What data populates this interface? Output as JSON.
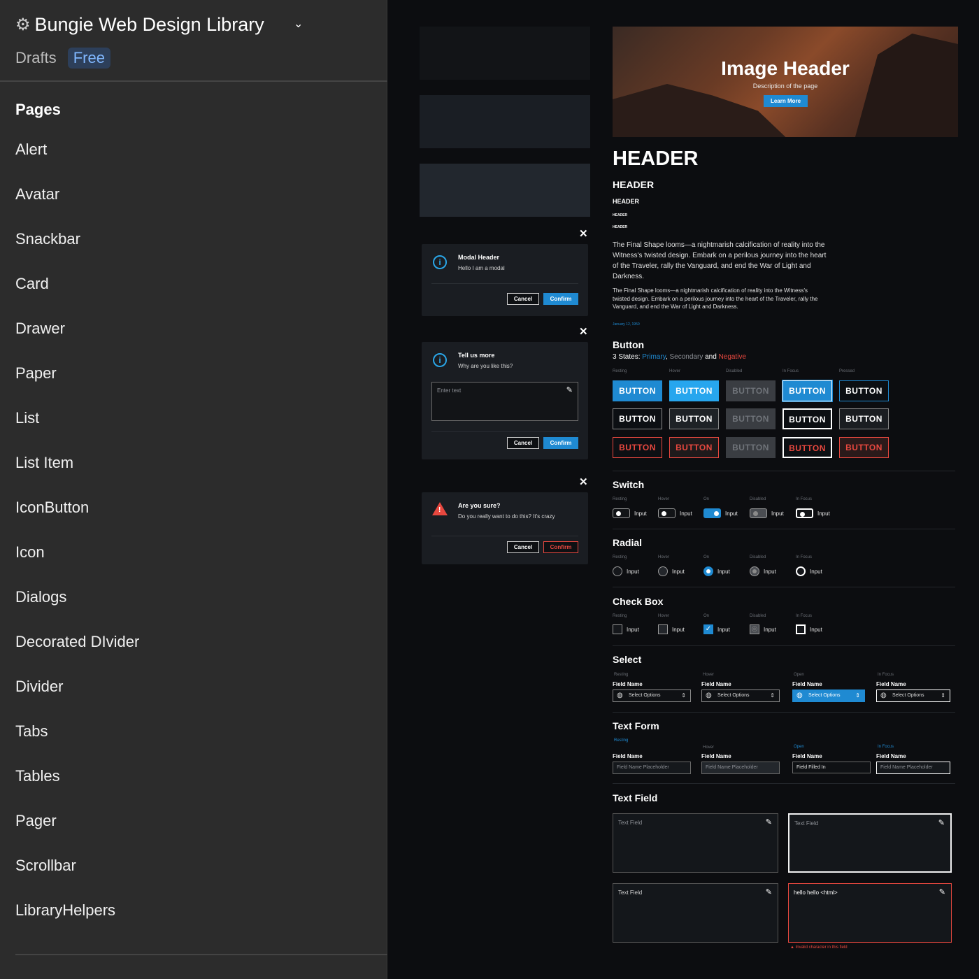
{
  "sidebar": {
    "title": "Bungie Web Design Library",
    "drafts": "Drafts",
    "plan": "Free",
    "pages_heading": "Pages",
    "pages": [
      "Alert",
      "Avatar",
      "Snackbar",
      "Card",
      "Drawer",
      "Paper",
      "List",
      "List Item",
      "IconButton",
      "Icon",
      "Dialogs",
      "Decorated DIvider",
      "Divider",
      "Tabs",
      "Tables",
      "Pager",
      "Scrollbar",
      "LibraryHelpers"
    ]
  },
  "swatches": [
    "#121417",
    "#1a1e24",
    "#22272e"
  ],
  "modals": {
    "m1": {
      "title": "Modal Header",
      "body": "Hello I am a modal",
      "cancel": "Cancel",
      "confirm": "Confirm"
    },
    "m2": {
      "title": "Tell us more",
      "body": "Why are you like this?",
      "placeholder": "Enter text",
      "cancel": "Cancel",
      "confirm": "Confirm"
    },
    "m3": {
      "title": "Are you sure?",
      "body": "Do you really want to do this? It's crazy",
      "cancel": "Cancel",
      "confirm": "Confirm"
    }
  },
  "hero": {
    "title": "Image Header",
    "subtitle": "Description of the page",
    "button": "Learn More"
  },
  "headers": [
    "HEADER",
    "HEADER",
    "HEADER",
    "HEADER",
    "HEADER"
  ],
  "para1": "The Final Shape looms—a nightmarish calcification of reality into the Witness's twisted design. Embark on a perilous journey into the heart of the Traveler, rally the Vanguard, and end the War of Light and Darkness.",
  "para2": "The Final Shape looms—a nightmarish calcification of reality into the Witness's twisted design. Embark on a perilous journey into the heart of the Traveler, rally the Vanguard, and end the War of Light and Darkness.",
  "date": "January 12, 1950",
  "button_section": {
    "title": "Button",
    "desc_prefix": "3 States: ",
    "primary": "Primary",
    "comma": ", ",
    "secondary": "Secondary",
    "and": " and ",
    "negative": "Negative",
    "states": [
      "Resting",
      "Hover",
      "Disabled",
      "In Focus",
      "Pressed"
    ],
    "label": "BUTTON"
  },
  "switch": {
    "title": "Switch",
    "states": [
      "Resting",
      "Hover",
      "On",
      "Disabled",
      "In Focus"
    ],
    "label": "Input"
  },
  "radial": {
    "title": "Radial",
    "states": [
      "Resting",
      "Hover",
      "On",
      "Disabled",
      "In Focus"
    ],
    "label": "Input"
  },
  "checkbox": {
    "title": "Check Box",
    "states": [
      "Resting",
      "Hover",
      "On",
      "Disabled",
      "In Focus"
    ],
    "label": "Input"
  },
  "select": {
    "title": "Select",
    "states": [
      "Resting",
      "Hover",
      "Open",
      "In Focus"
    ],
    "field": "Field Name",
    "option": "Select Options"
  },
  "textform": {
    "title": "Text Form",
    "states": [
      "Resting",
      "Hover",
      "Open",
      "In Focus"
    ],
    "field": "Field Name",
    "placeholder": "Field Name Placeholder",
    "filled": "Field Filled In"
  },
  "textfield": {
    "title": "Text Field",
    "placeholder": "Text Field",
    "filled": "hello hello <html>",
    "error": "Invalid character in this field"
  },
  "colors": {
    "primary": "#1f8ad2",
    "secondary": "#8d9096",
    "negative": "#e8483f"
  }
}
